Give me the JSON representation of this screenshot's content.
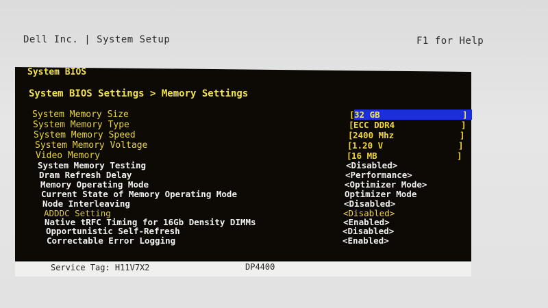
{
  "header": {
    "title": "Dell Inc. | System Setup",
    "help": "F1 for Help"
  },
  "panel": {
    "section_title": "System BIOS",
    "breadcrumb": "System BIOS Settings > Memory Settings"
  },
  "settings": [
    {
      "label": "System Memory Size",
      "value": "32 GB"
    },
    {
      "label": "System Memory Type",
      "value": "ECC DDR4"
    },
    {
      "label": "System Memory Speed",
      "value": "2400 Mhz"
    },
    {
      "label": "System Memory Voltage",
      "value": "1.20 V"
    },
    {
      "label": "Video Memory",
      "value": "16 MB"
    },
    {
      "label": "System Memory Testing",
      "value": "<Disabled>"
    },
    {
      "label": "Dram Refresh Delay",
      "value": "<Performance>"
    },
    {
      "label": "Memory Operating Mode",
      "value": "<Optimizer Mode>"
    },
    {
      "label": "Current State of Memory Operating Mode",
      "value": "Optimizer Mode"
    },
    {
      "label": "Node Interleaving",
      "value": "<Disabled>"
    },
    {
      "label": "ADDDC Setting",
      "value": "<Disabled>"
    },
    {
      "label": "Native tRFC Timing for 16Gb Density DIMMs",
      "value": "<Enabled>"
    },
    {
      "label": "Opportunistic Self-Refresh",
      "value": "<Disabled>"
    },
    {
      "label": "Correctable Error Logging",
      "value": "<Enabled>"
    }
  ],
  "footer": {
    "service_tag": "Service Tag: H11V7X2",
    "model": "DP4400"
  },
  "colors": {
    "panel_bg": "#0d0a06",
    "yellow": "#f2e24a",
    "highlight": "#1a2fd8"
  }
}
